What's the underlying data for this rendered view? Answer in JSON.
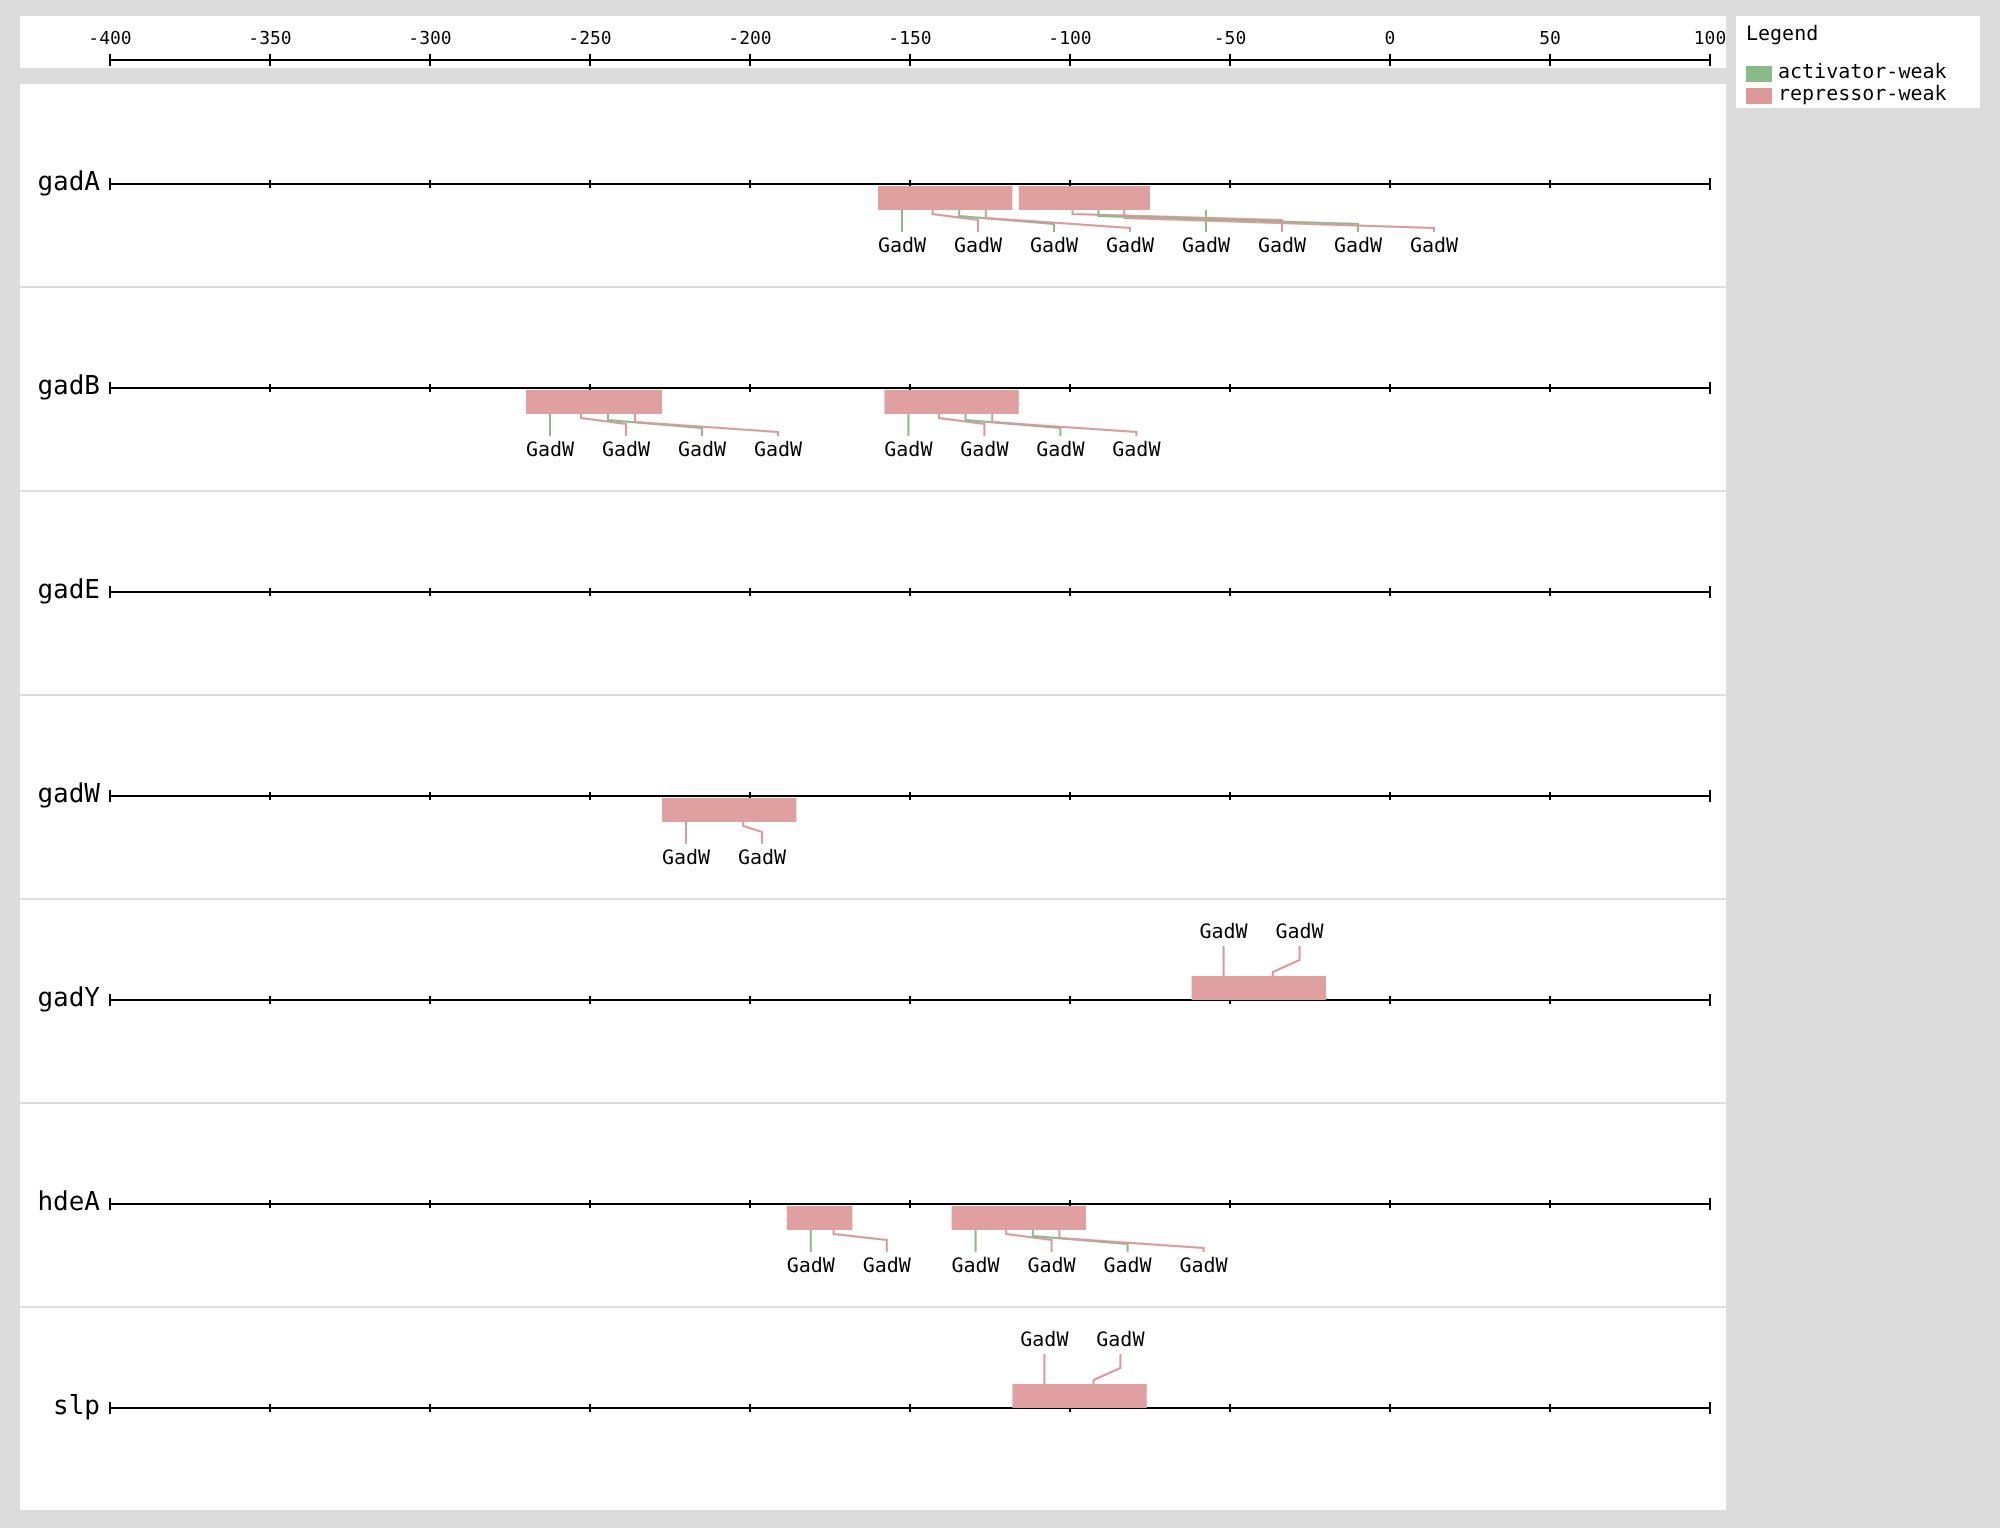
{
  "axis": {
    "ticks": [
      "-400",
      "-350",
      "-300",
      "-250",
      "-200",
      "-150",
      "-100",
      "-50",
      "0",
      "50",
      "100"
    ]
  },
  "legend": {
    "title": "Legend",
    "items": [
      {
        "label": "activator-weak",
        "color": "#88bb88"
      },
      {
        "label": "repressor-weak",
        "color": "#dd9999"
      }
    ]
  },
  "genes": [
    {
      "name": "gadA",
      "sites": [
        {
          "labels": [
            {
              "text": "GadW",
              "color": "#88bb88"
            },
            {
              "text": "GadW",
              "color": "#dd9999"
            },
            {
              "text": "GadW",
              "color": "#88bb88"
            },
            {
              "text": "GadW",
              "color": "#dd9999"
            }
          ]
        },
        {
          "labels": [
            {
              "text": "GadW",
              "color": "#88bb88"
            },
            {
              "text": "GadW",
              "color": "#dd9999"
            },
            {
              "text": "GadW",
              "color": "#88bb88"
            },
            {
              "text": "GadW",
              "color": "#dd9999"
            }
          ]
        }
      ]
    },
    {
      "name": "gadB",
      "sites": [
        {
          "labels": [
            {
              "text": "GadW",
              "color": "#88bb88"
            },
            {
              "text": "GadW",
              "color": "#dd9999"
            },
            {
              "text": "GadW",
              "color": "#88bb88"
            },
            {
              "text": "GadW",
              "color": "#dd9999"
            }
          ]
        },
        {
          "labels": [
            {
              "text": "GadW",
              "color": "#88bb88"
            },
            {
              "text": "GadW",
              "color": "#dd9999"
            },
            {
              "text": "GadW",
              "color": "#88bb88"
            },
            {
              "text": "GadW",
              "color": "#dd9999"
            }
          ]
        }
      ]
    },
    {
      "name": "gadE"
    },
    {
      "name": "gadW",
      "sites": [
        {
          "labels": [
            {
              "text": "GadW",
              "color": "#dd9999"
            },
            {
              "text": "GadW",
              "color": "#dd9999"
            }
          ]
        }
      ]
    },
    {
      "name": "gadY",
      "sites": [
        {
          "labels": [
            {
              "text": "GadW",
              "color": "#dd9999"
            },
            {
              "text": "GadW",
              "color": "#dd9999"
            }
          ]
        }
      ]
    },
    {
      "name": "hdeA",
      "sites": [
        {
          "labels": [
            {
              "text": "GadW",
              "color": "#88bb88"
            },
            {
              "text": "GadW",
              "color": "#dd9999"
            }
          ]
        },
        {
          "labels": [
            {
              "text": "GadW",
              "color": "#88bb88"
            },
            {
              "text": "GadW",
              "color": "#dd9999"
            },
            {
              "text": "GadW",
              "color": "#88bb88"
            },
            {
              "text": "GadW",
              "color": "#dd9999"
            }
          ]
        }
      ]
    },
    {
      "name": "slp",
      "sites": [
        {
          "labels": [
            {
              "text": "GadW",
              "color": "#dd9999"
            },
            {
              "text": "GadW",
              "color": "#dd9999"
            }
          ]
        }
      ]
    }
  ]
}
